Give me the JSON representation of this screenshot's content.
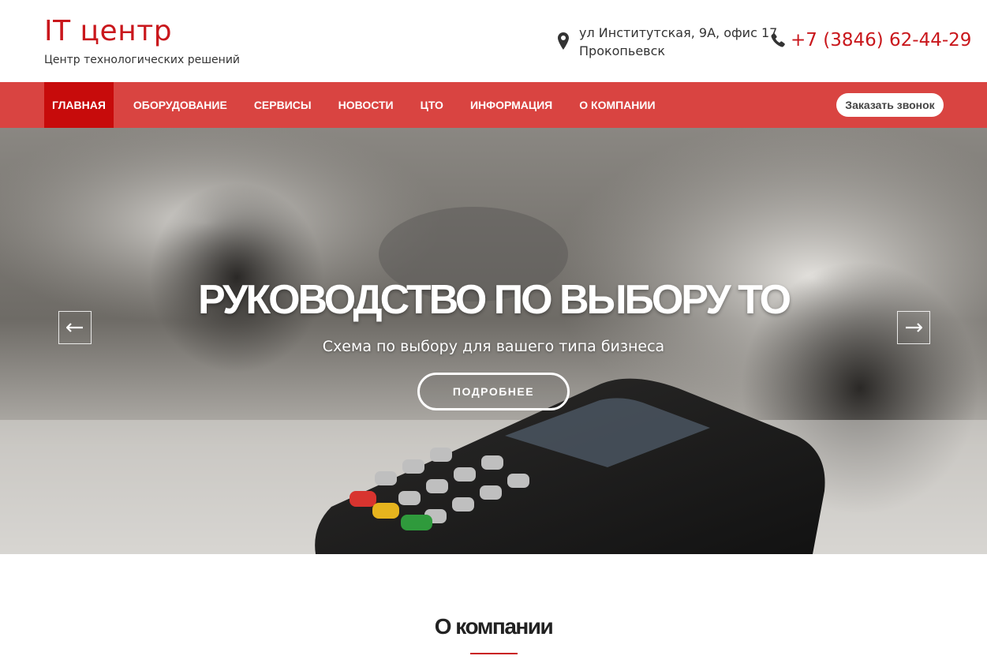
{
  "header": {
    "brand_title": "IT центр",
    "brand_subtitle": "Центр технологических решений",
    "address_line1": "ул Институтская, 9А, офис 17",
    "address_line2": "Прокопьевск",
    "phone": "+7 (3846) 62-44-29",
    "icons": {
      "address": "map-pin-icon",
      "phone": "phone-icon"
    }
  },
  "nav": {
    "items": [
      {
        "label": "ГЛАВНАЯ",
        "active": true
      },
      {
        "label": "ОБОРУДОВАНИЕ"
      },
      {
        "label": "СЕРВИСЫ"
      },
      {
        "label": "НОВОСТИ"
      },
      {
        "label": "ЦТО"
      },
      {
        "label": "ИНФОРМАЦИЯ"
      },
      {
        "label": "О КОМПАНИИ"
      }
    ],
    "callback_label": "Заказать звонок"
  },
  "hero": {
    "title": "РУКОВОДСТВО ПО ВЫБОРУ ТО",
    "subtitle": "Схема по выбору для вашего типа бизнеса",
    "button_label": "ПОДРОБНЕЕ",
    "icons": {
      "prev": "arrow-left-icon",
      "next": "arrow-right-icon"
    }
  },
  "about": {
    "title": "О компании"
  },
  "colors": {
    "brand_red": "#c9171c",
    "nav_bg": "#d94441",
    "nav_active": "#c70b0b"
  }
}
